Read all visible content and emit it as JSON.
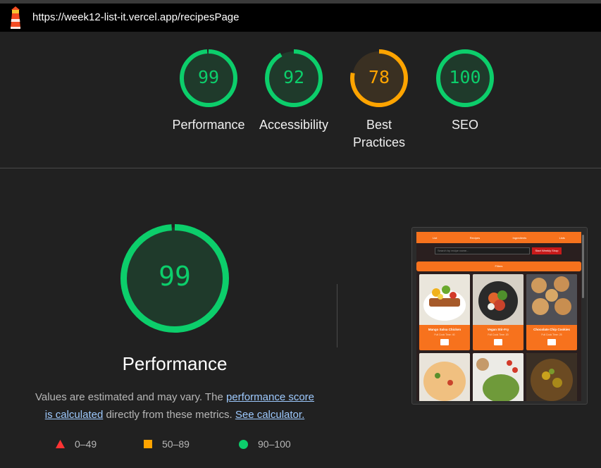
{
  "browser": {
    "url": "https://week12-list-it.vercel.app/recipesPage"
  },
  "colors": {
    "pass": "#0cce6b",
    "average": "#ffa400",
    "fail": "#ff3333",
    "accent_orange": "#f7721d"
  },
  "gauges": [
    {
      "score": "99",
      "label": "Performance",
      "fraction": 0.99,
      "rating": "pass"
    },
    {
      "score": "92",
      "label": "Accessibility",
      "fraction": 0.92,
      "rating": "pass"
    },
    {
      "score": "78",
      "label": "Best Practices",
      "fraction": 0.78,
      "rating": "average"
    },
    {
      "score": "100",
      "label": "SEO",
      "fraction": 1.0,
      "rating": "pass"
    }
  ],
  "performance": {
    "score": "99",
    "fraction": 0.99,
    "title": "Performance",
    "desc_prefix": "Values are estimated and may vary. The ",
    "link_score": "performance score is calculated",
    "desc_middle": " directly from these metrics. ",
    "link_calc": "See calculator."
  },
  "legend": {
    "fail": "0–49",
    "average": "50–89",
    "pass": "90–100"
  },
  "screenshot": {
    "nav": [
      "List",
      "Recipes",
      "Ingredients",
      "Lists"
    ],
    "search_placeholder": "Search by recipe name...",
    "week_button": "Start Weekly Shop",
    "filters": "Filters",
    "cards": [
      {
        "name": "Mango Salsa Chicken",
        "meta": "Full Cook Time: 40",
        "img": "chicken"
      },
      {
        "name": "Vegan Stir-Fry",
        "meta": "Full Cook Time: 20",
        "img": "stirfry"
      },
      {
        "name": "Chocolate Chip Cookies",
        "meta": "Full Cook Time: 25",
        "img": "cookies"
      },
      {
        "name": "",
        "meta": "",
        "img": "pasta"
      },
      {
        "name": "",
        "meta": "",
        "img": "bowl"
      },
      {
        "name": "",
        "meta": "",
        "img": "skillet"
      }
    ]
  }
}
